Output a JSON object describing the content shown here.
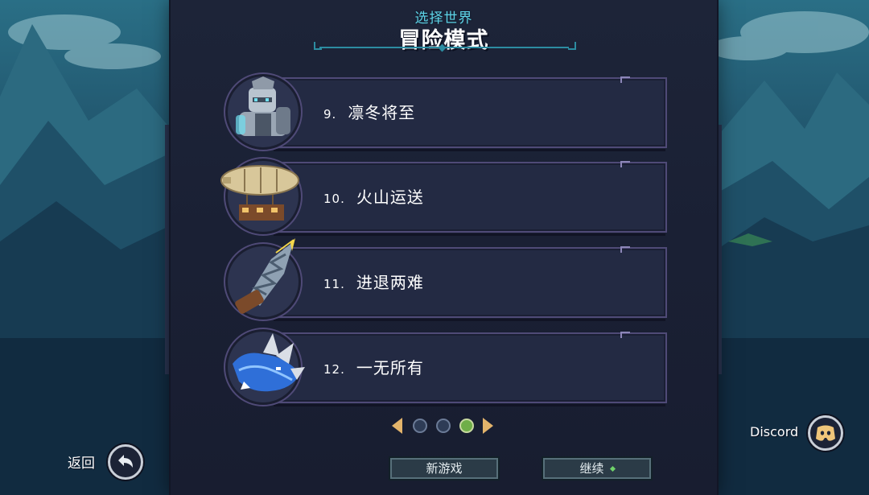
{
  "header": {
    "subtitle": "选择世界",
    "title": "冒险模式"
  },
  "levels": [
    {
      "number": "9.",
      "name": "凛冬将至",
      "icon": "armored-knight-icon"
    },
    {
      "number": "10.",
      "name": "火山运送",
      "icon": "airship-icon"
    },
    {
      "number": "11.",
      "name": "进退两难",
      "icon": "drill-icon"
    },
    {
      "number": "12.",
      "name": "一无所有",
      "icon": "blue-dragon-icon"
    }
  ],
  "pager": {
    "pages": 3,
    "current_page": 3
  },
  "buttons": {
    "new_game": "新游戏",
    "continue": "继续"
  },
  "back": {
    "label": "返回",
    "icon": "back-arrow-icon"
  },
  "discord": {
    "label": "Discord",
    "icon": "discord-icon"
  },
  "colors": {
    "accent": "#5ed3e6",
    "card_border": "#4f4a77",
    "pager_arrow": "#e3b46b",
    "active_dot": "#6fae48"
  }
}
